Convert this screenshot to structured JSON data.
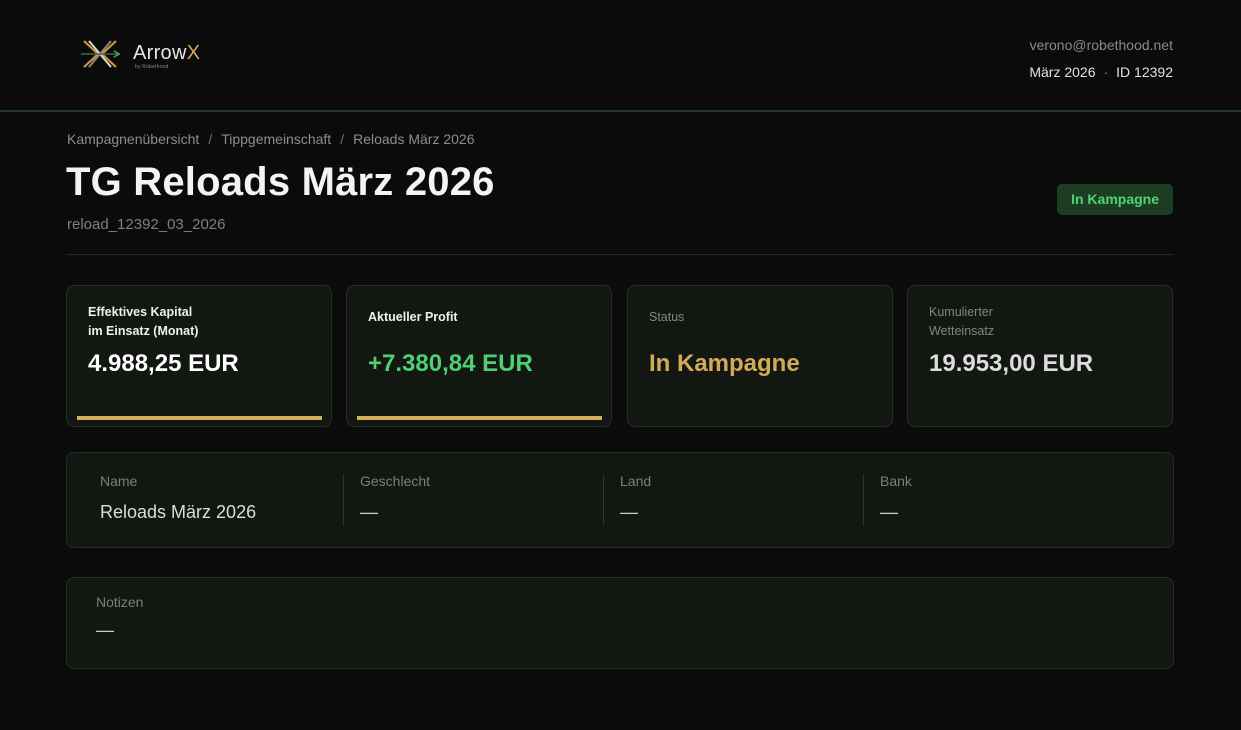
{
  "brand": {
    "name_main": "Arrow",
    "name_accent": "X",
    "tagline": "by Robethood",
    "accent_color": "#d8a94e"
  },
  "user": {
    "email": "verono@robethood.net",
    "period": "März 2026",
    "separator": "·",
    "id_label": "ID 12392"
  },
  "breadcrumb": {
    "items": [
      "Kampagnenübersicht",
      "Tippgemeinschaft",
      "Reloads März 2026"
    ],
    "separator": "/"
  },
  "page": {
    "title": "TG Reloads März 2026",
    "id": "reload_12392_03_2026",
    "status_badge": "In Kampagne"
  },
  "cards": [
    {
      "label_line1": "Effektives Kapital",
      "label_line2": "im Einsatz (Monat)",
      "value": "4.988,25 EUR",
      "value_color": "#ffffff",
      "underline_color": "#d7ae5b"
    },
    {
      "label": "Aktueller Profit",
      "value": "+7.380,84 EUR",
      "value_color": "#4fce72",
      "underline_color": "#d7ae5b"
    },
    {
      "label": "Status",
      "value": "In Kampagne",
      "value_color": "#d2aa59"
    },
    {
      "label_line1": "Kumulierter",
      "label_line2": "Wetteinsatz",
      "value": "19.953,00 EUR",
      "value_color": "#dcdcdc"
    }
  ],
  "info": {
    "name_label": "Name",
    "name_value": "Reloads März 2026",
    "gender_label": "Geschlecht",
    "gender_value": "—",
    "country_label": "Land",
    "country_value": "—",
    "bank_label": "Bank",
    "bank_value": "—"
  },
  "notes": {
    "label": "Notizen",
    "value": "—"
  },
  "colors": {
    "background": "#0b0b0b",
    "panel": "#121712",
    "status_green": "#52d375",
    "gold": "#d7ae5b"
  }
}
